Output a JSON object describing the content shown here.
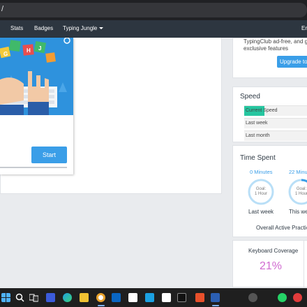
{
  "browser": {
    "url_text": "/"
  },
  "nav": {
    "stats": "Stats",
    "badges": "Badges",
    "typing_jungle": "Typing Jungle",
    "language": "Er"
  },
  "lesson": {
    "start": "Start"
  },
  "upgrade": {
    "line1": "TypingClub ad-free, and ge",
    "line2": "exclusive features",
    "button": "Upgrade to P"
  },
  "speed": {
    "title": "Speed",
    "rows": [
      {
        "label": "Current Speed"
      },
      {
        "label": "Last week"
      },
      {
        "label": "Last month"
      }
    ]
  },
  "time_spent": {
    "title": "Time Spent",
    "left": {
      "minutes": "0 Minutes",
      "goal_line1": "Goal:",
      "goal_line2": "1 Hour",
      "caption": "Last week"
    },
    "right": {
      "minutes": "22 Minu",
      "goal_line1": "Goal:",
      "goal_line2": "1 Hour",
      "caption": "This we"
    },
    "overall": "Overall Active Practic"
  },
  "keyboard": {
    "title": "Keyboard Coverage",
    "value": "21%"
  },
  "colors": {
    "accent": "#3a9ee8",
    "speed_fill": "#26c6a0",
    "coverage": "#d06ad0",
    "navbar": "#2d3640"
  },
  "taskbar": {
    "icons": [
      "windows-icon",
      "search-icon",
      "task-view-icon",
      "widgets-icon",
      "edge-icon",
      "explorer-icon",
      "chrome-icon",
      "mail-icon",
      "amazon-icon",
      "settings-icon",
      "terminal-icon",
      "app-icon",
      "brave-icon",
      "word-icon",
      "user-icon",
      "whatsapp-icon",
      "chat-icon"
    ]
  }
}
